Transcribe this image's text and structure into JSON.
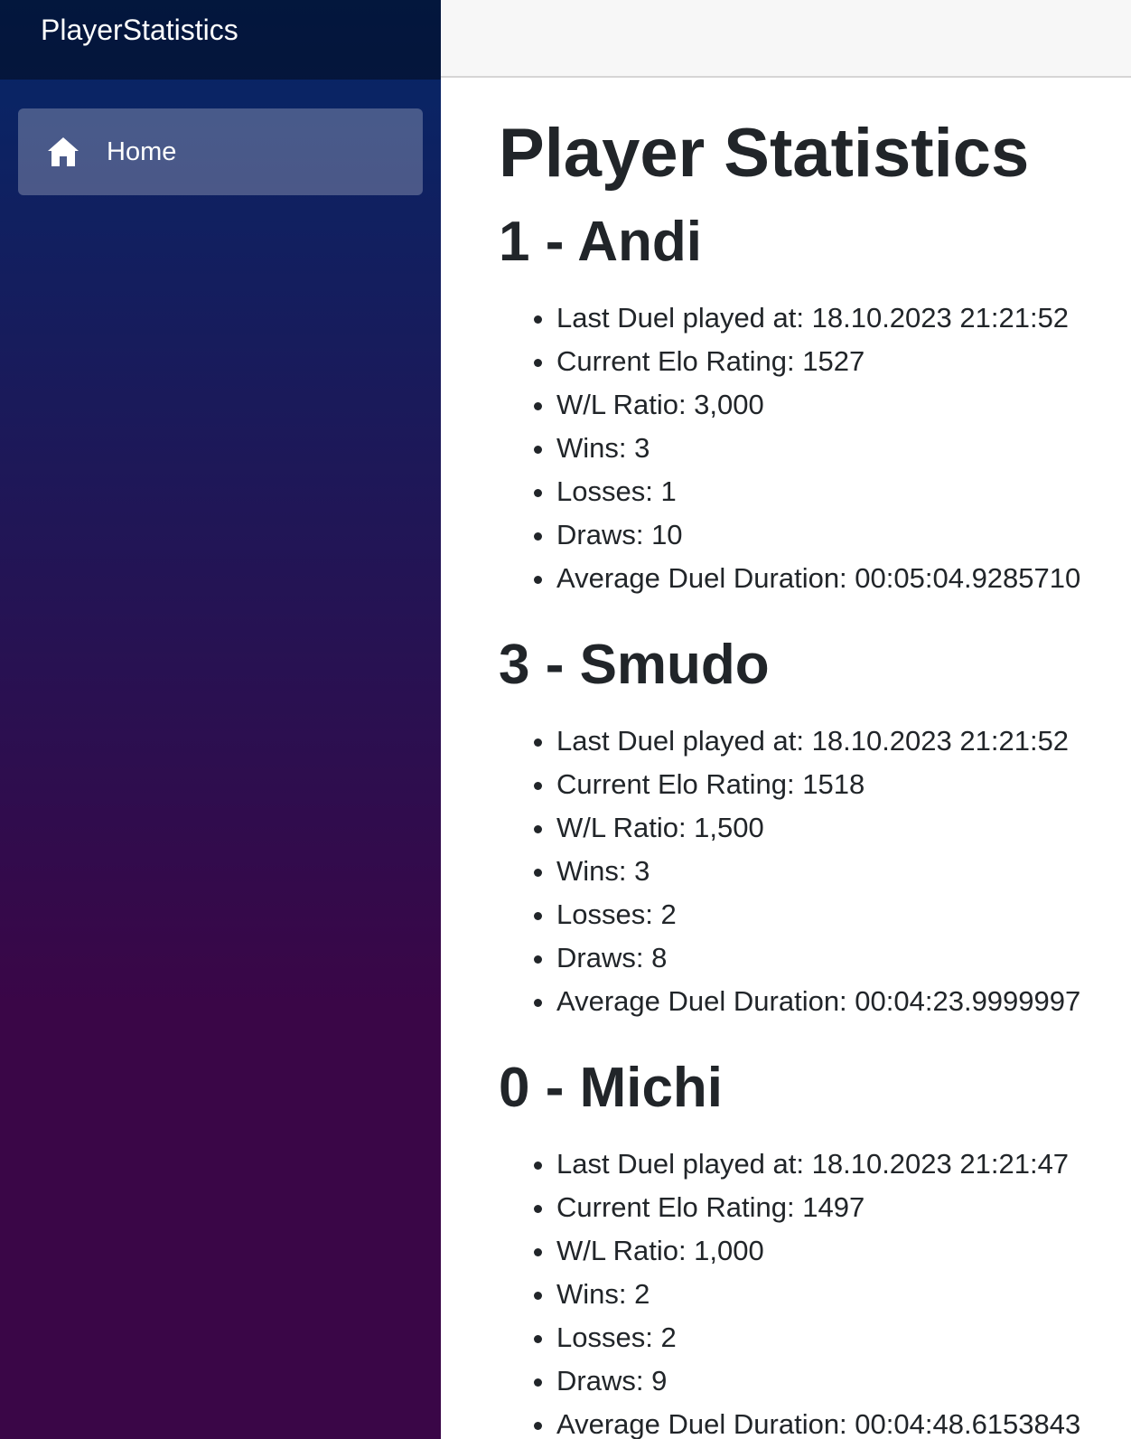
{
  "sidebar": {
    "brand": "PlayerStatistics",
    "nav": [
      {
        "label": "Home",
        "icon": "home-icon"
      }
    ]
  },
  "main": {
    "title": "Player Statistics",
    "players": [
      {
        "heading": "1 - Andi",
        "stats": [
          "Last Duel played at: 18.10.2023 21:21:52",
          "Current Elo Rating: 1527",
          "W/L Ratio: 3,000",
          "Wins: 3",
          "Losses: 1",
          "Draws: 10",
          "Average Duel Duration: 00:05:04.9285710"
        ]
      },
      {
        "heading": "3 - Smudo",
        "stats": [
          "Last Duel played at: 18.10.2023 21:21:52",
          "Current Elo Rating: 1518",
          "W/L Ratio: 1,500",
          "Wins: 3",
          "Losses: 2",
          "Draws: 8",
          "Average Duel Duration: 00:04:23.9999997"
        ]
      },
      {
        "heading": "0 - Michi",
        "stats": [
          "Last Duel played at: 18.10.2023 21:21:47",
          "Current Elo Rating: 1497",
          "W/L Ratio: 1,000",
          "Wins: 2",
          "Losses: 2",
          "Draws: 9",
          "Average Duel Duration: 00:04:48.6153843"
        ]
      }
    ]
  },
  "colors": {
    "sidebar_gradient_top": "#052767",
    "sidebar_gradient_bottom": "#3a0647",
    "text": "#212529",
    "top_row_bg": "#f7f7f7"
  }
}
